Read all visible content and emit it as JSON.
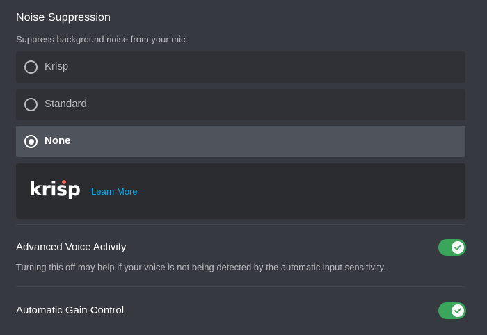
{
  "noise_suppression": {
    "title": "Noise Suppression",
    "description": "Suppress background noise from your mic.",
    "options": [
      {
        "label": "Krisp",
        "selected": false
      },
      {
        "label": "Standard",
        "selected": false
      },
      {
        "label": "None",
        "selected": true
      }
    ],
    "krisp_card": {
      "logo_text": "krisp",
      "learn_more": "Learn More"
    }
  },
  "advanced_voice_activity": {
    "title": "Advanced Voice Activity",
    "description": "Turning this off may help if your voice is not being detected by the automatic input sensitivity.",
    "enabled": true
  },
  "automatic_gain_control": {
    "title": "Automatic Gain Control",
    "enabled": true
  },
  "colors": {
    "background": "#36393f",
    "option_bg": "#2f3136",
    "option_selected_bg": "#4f545c",
    "toggle_on": "#3ba55c",
    "link": "#00b0f4",
    "krisp_accent": "#f35b55"
  },
  "icons": {
    "radio": "radio-button-icon",
    "toggle_check": "checkmark-icon"
  }
}
